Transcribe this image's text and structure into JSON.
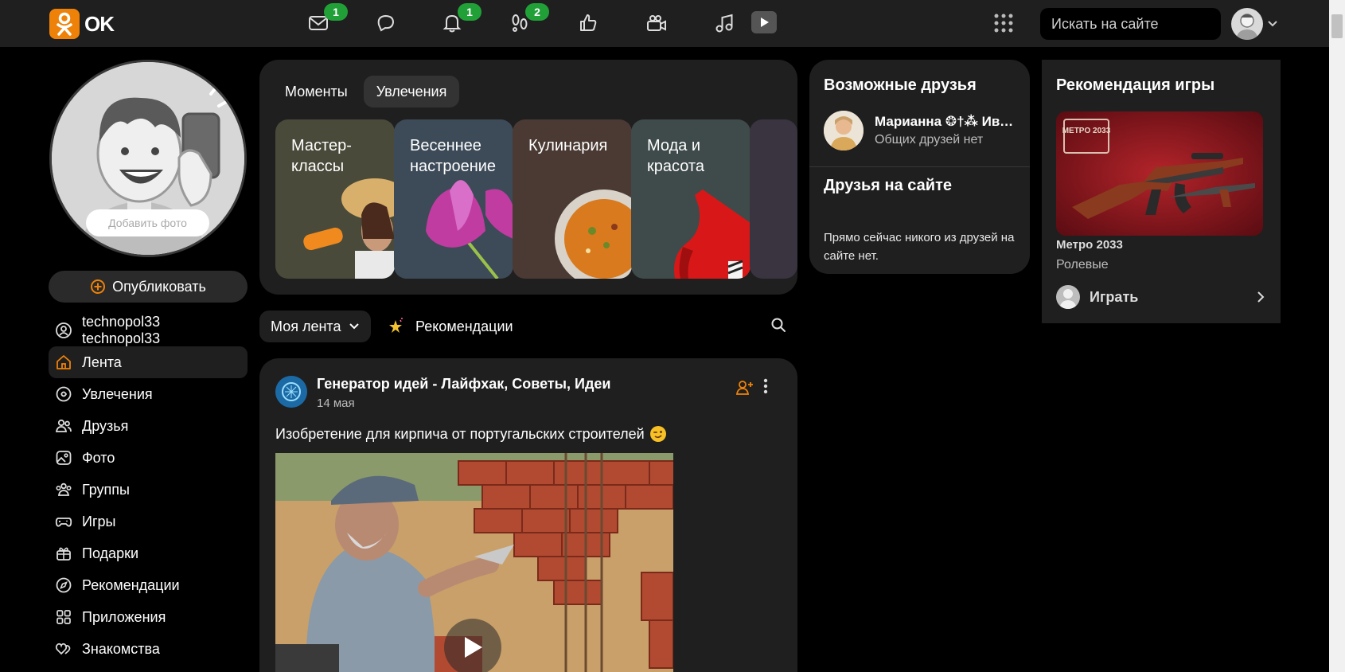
{
  "header": {
    "logo_text": "OK",
    "badges": {
      "messages": "1",
      "notifications": "1",
      "guests": "2"
    },
    "search_placeholder": "Искать на сайте",
    "accent_color": "#ee8208",
    "badge_color": "#21a038"
  },
  "profile": {
    "add_photo_label": "Добавить фото",
    "publish_label": "Опубликовать"
  },
  "sidebar": {
    "items": [
      {
        "label": "technopol33 technopol33",
        "icon": "user-icon"
      },
      {
        "label": "Лента",
        "icon": "home-icon",
        "active": true
      },
      {
        "label": "Увлечения",
        "icon": "hobbies-icon"
      },
      {
        "label": "Друзья",
        "icon": "friends-icon"
      },
      {
        "label": "Фото",
        "icon": "photo-icon"
      },
      {
        "label": "Группы",
        "icon": "groups-icon"
      },
      {
        "label": "Игры",
        "icon": "gamepad-icon"
      },
      {
        "label": "Подарки",
        "icon": "gift-icon"
      },
      {
        "label": "Рекомендации",
        "icon": "compass-icon"
      },
      {
        "label": "Приложения",
        "icon": "apps-icon"
      },
      {
        "label": "Знакомства",
        "icon": "hearts-icon"
      }
    ]
  },
  "moments": {
    "tabs": [
      "Моменты",
      "Увлечения"
    ],
    "active_tab": "Увлечения",
    "cards": [
      {
        "title": "Мастер-\nклассы",
        "color": "#4a4a3a"
      },
      {
        "title": "Весеннее\nнастроение",
        "color": "#3d4a58"
      },
      {
        "title": "Кулинария",
        "color": "#4a3a33"
      },
      {
        "title": "Мода и\nкрасота",
        "color": "#3f4a4a"
      }
    ]
  },
  "feed": {
    "filter_label": "Моя лента",
    "recommendations_label": "Рекомендации"
  },
  "post": {
    "author": "Генератор идей - Лайфхак, Советы, Идеи",
    "date": "14 мая",
    "text": "Изобретение для кирпича от португальских строителей"
  },
  "friends": {
    "title": "Возможные друзья",
    "suggestion_name": "Марианна ❂†⁂ Ива…",
    "suggestion_sub": "Общих друзей нет",
    "online_title": "Друзья на сайте",
    "online_text": "Прямо сейчас никого из друзей на сайте нет."
  },
  "game": {
    "title": "Рекомендация игры",
    "logo_text": "METPO 2033",
    "name": "Метро 2033",
    "genre": "Ролевые",
    "play_label": "Играть"
  }
}
